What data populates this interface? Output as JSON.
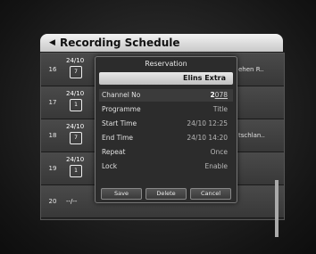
{
  "schedule": {
    "title": "Recording Schedule",
    "rows": [
      {
        "num": "16",
        "date": "24/10",
        "right": "ehen R.."
      },
      {
        "num": "17",
        "date": "24/10",
        "right": ""
      },
      {
        "num": "18",
        "date": "24/10",
        "right": "tschlan.."
      },
      {
        "num": "19",
        "date": "24/10",
        "right": ""
      },
      {
        "num": "20",
        "date": "--/--",
        "right": ""
      }
    ]
  },
  "dialog": {
    "title": "Reservation",
    "channel_name": "Elins Extra",
    "fields": {
      "channel_no": {
        "label": "Channel No",
        "value_cursor": "2",
        "value_rest": "078"
      },
      "programme": {
        "label": "Programme",
        "value": "Title"
      },
      "start_time": {
        "label": "Start Time",
        "value": "24/10 12:25"
      },
      "end_time": {
        "label": "End Time",
        "value": "24/10 14:20"
      },
      "repeat": {
        "label": "Repeat",
        "value": "Once"
      },
      "lock": {
        "label": "Lock",
        "value": "Enable"
      }
    },
    "buttons": {
      "save": "Save",
      "delete": "Delete",
      "cancel": "Cancel"
    }
  }
}
